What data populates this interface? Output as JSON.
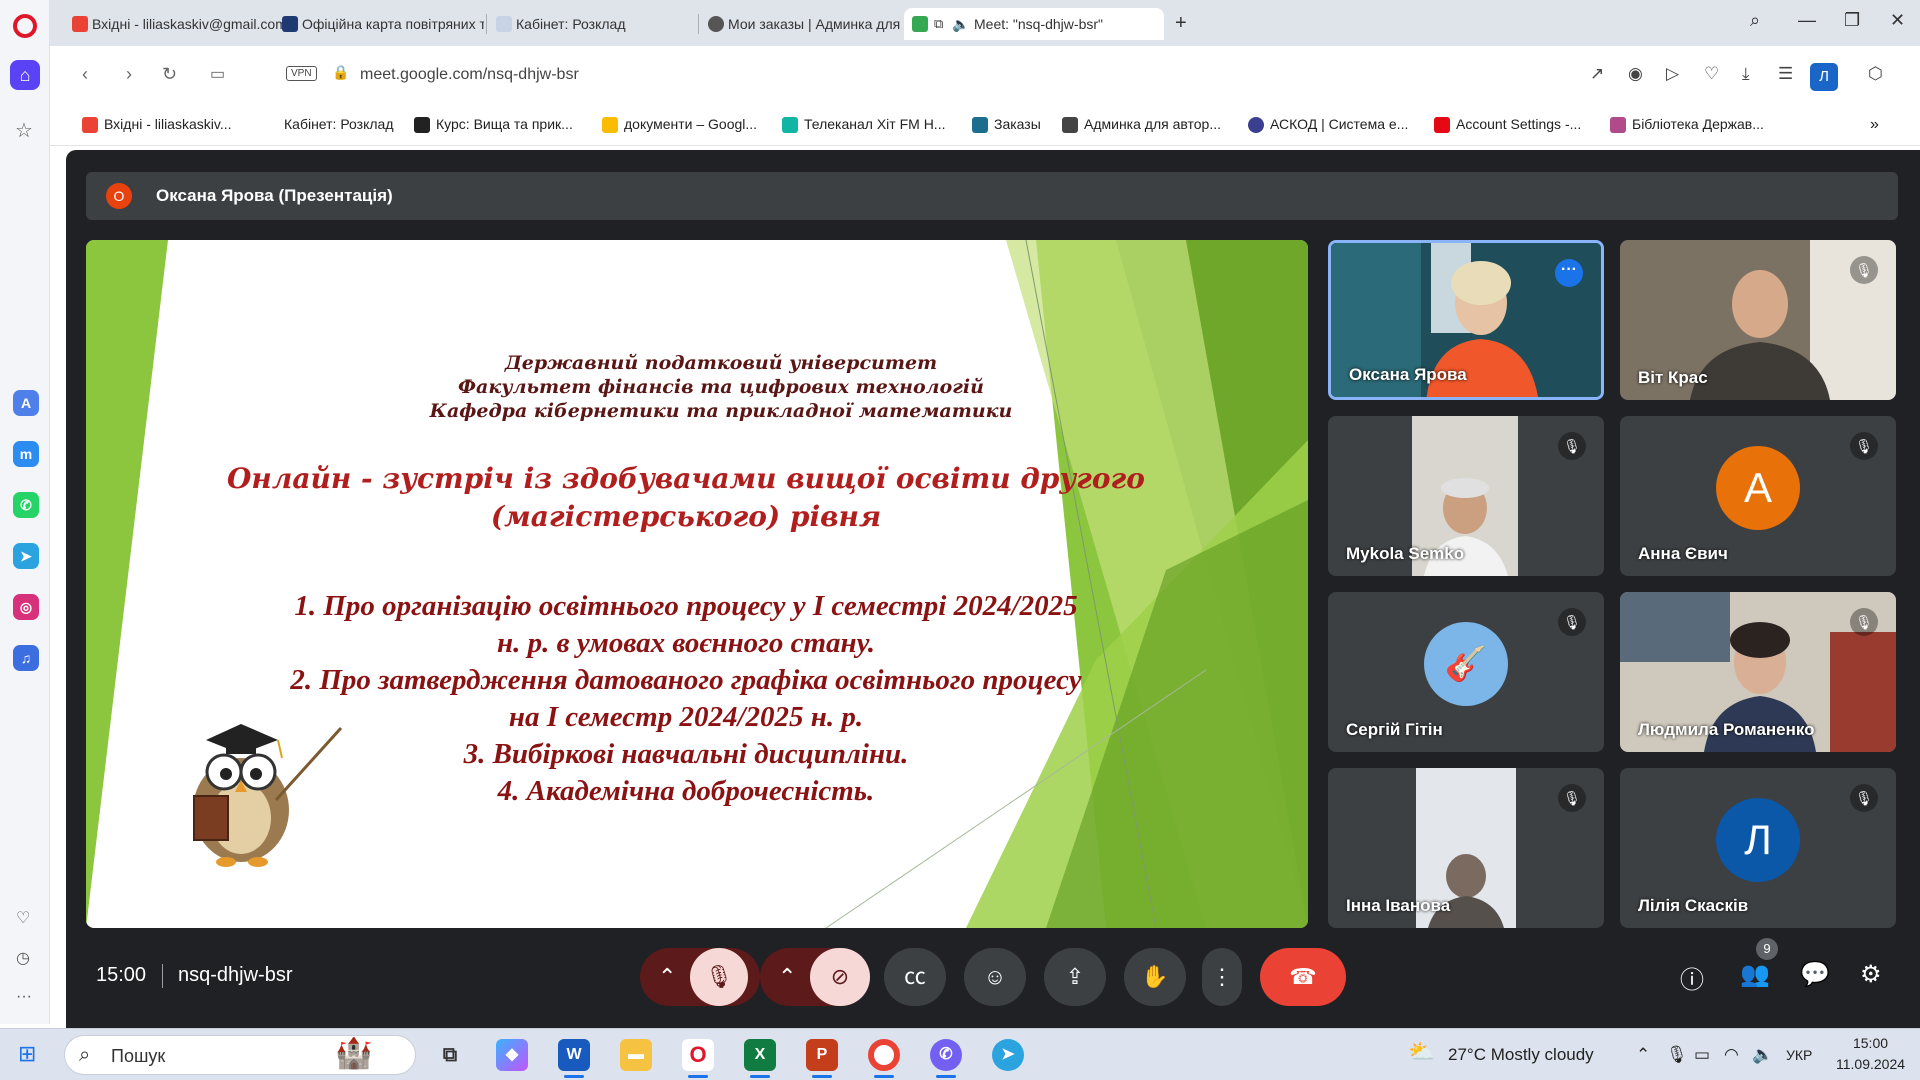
{
  "tabs": [
    {
      "label": "Вхідні - liliaskaskiv@gmail.com",
      "color": "#ea4335"
    },
    {
      "label": "Офіційна карта повітряних тривог",
      "color": "#1f3a73"
    },
    {
      "label": "Кабінет: Розклад",
      "color": "#c9d3e6"
    },
    {
      "label": "Мои заказы | Админка для авторов",
      "color": "#555555"
    },
    {
      "label": "Meet: \"nsq-dhjw-bsr\"",
      "color": "#34a853"
    }
  ],
  "url": "meet.google.com/nsq-dhjw-bsr",
  "vpn_label": "VPN",
  "profile_initial": "Л",
  "bookmarks": [
    {
      "label": "Вхідні - liliaskaskiv...",
      "color": "#ea4335"
    },
    {
      "label": "Кабінет: Розклад",
      "color": "#ffffff"
    },
    {
      "label": "Курс: Вища та прик...",
      "color": "#222222"
    },
    {
      "label": "документи – Googl...",
      "color": "#fbbc04"
    },
    {
      "label": "Телеканал Хіт FM Н...",
      "color": "#11b5a4"
    },
    {
      "label": "Заказы",
      "color": "#1d6e8e"
    },
    {
      "label": "Админка для автор...",
      "color": "#444444"
    },
    {
      "label": "АСКОД | Система е...",
      "color": "#3b3f8f"
    },
    {
      "label": "Account Settings -...",
      "color": "#e50914"
    },
    {
      "label": "Бібліотека Держав...",
      "color": "#b04a8a"
    }
  ],
  "presenter": {
    "initial": "О",
    "label": "Оксана Ярова (Презентація)"
  },
  "slide": {
    "university": "Державний податковий університет",
    "faculty": "Факультет фінансів та цифрових технологій",
    "department": "Кафедра кібернетики та прикладної математики",
    "headline_1": "Онлайн - зустріч із здобувачами вищої освіти другого",
    "headline_2": "(магістерського) рівня",
    "agenda": [
      "1. Про організацію освітнього процесу у І семестрі 2024/2025",
      "н. р. в умовах воєнного стану.",
      "2. Про затвердження датованого графіка освітнього процесу",
      "на І семестр 2024/2025 н. р.",
      "3. Вибіркові навчальні дисципліни.",
      "4. Академічна доброчесність."
    ]
  },
  "participants": [
    {
      "name": "Оксана Ярова",
      "type": "video",
      "bg": "#b8643a",
      "active": true
    },
    {
      "name": "Віт Крас",
      "type": "video",
      "bg": "#8a7f72"
    },
    {
      "name": "Mykola Semko",
      "type": "video",
      "bg": "#d9d6cf"
    },
    {
      "name": "Анна Євич",
      "type": "avatar",
      "initial": "А",
      "avatar_color": "#e8710a"
    },
    {
      "name": "Сергій Гітін",
      "type": "avatar",
      "initial": "",
      "avatar_color": "#7cb5e8"
    },
    {
      "name": "Людмила Романенко",
      "type": "video",
      "bg": "#c9c3b8"
    },
    {
      "name": "Інна Іванова",
      "type": "video",
      "bg": "#e3e6ea"
    },
    {
      "name": "Лілія Скасків",
      "type": "avatar",
      "initial": "Л",
      "avatar_color": "#0b57a8"
    }
  ],
  "meeting": {
    "time": "15:00",
    "code": "nsq-dhjw-bsr",
    "participant_count": "9"
  },
  "taskbar": {
    "search_placeholder": "Пошук",
    "weather": "27°C  Mostly cloudy",
    "language": "УКР",
    "clock_time": "15:00",
    "clock_date": "11.09.2024"
  }
}
